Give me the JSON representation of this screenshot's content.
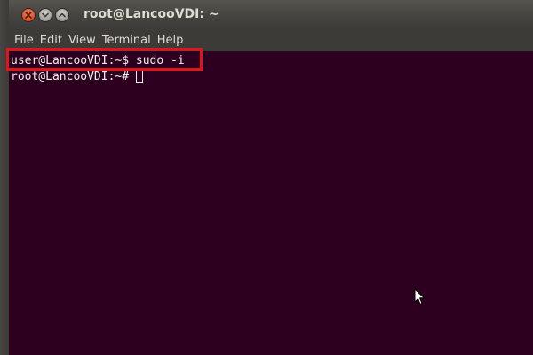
{
  "window": {
    "title": "root@LancooVDI: ~",
    "buttons": {
      "close": "close-icon",
      "minimize": "minimize-icon",
      "maximize": "maximize-icon"
    }
  },
  "menubar": {
    "items": [
      {
        "label": "File"
      },
      {
        "label": "Edit"
      },
      {
        "label": "View"
      },
      {
        "label": "Terminal"
      },
      {
        "label": "Help"
      }
    ]
  },
  "terminal": {
    "lines": [
      {
        "prompt": "user@LancooVDI:~$",
        "command": "sudo -i"
      },
      {
        "prompt": "root@LancooVDI:~#",
        "command": ""
      }
    ],
    "background": "#2c001e",
    "foreground": "#eeeeec"
  },
  "annotation": {
    "highlight_color": "#e0151b"
  }
}
